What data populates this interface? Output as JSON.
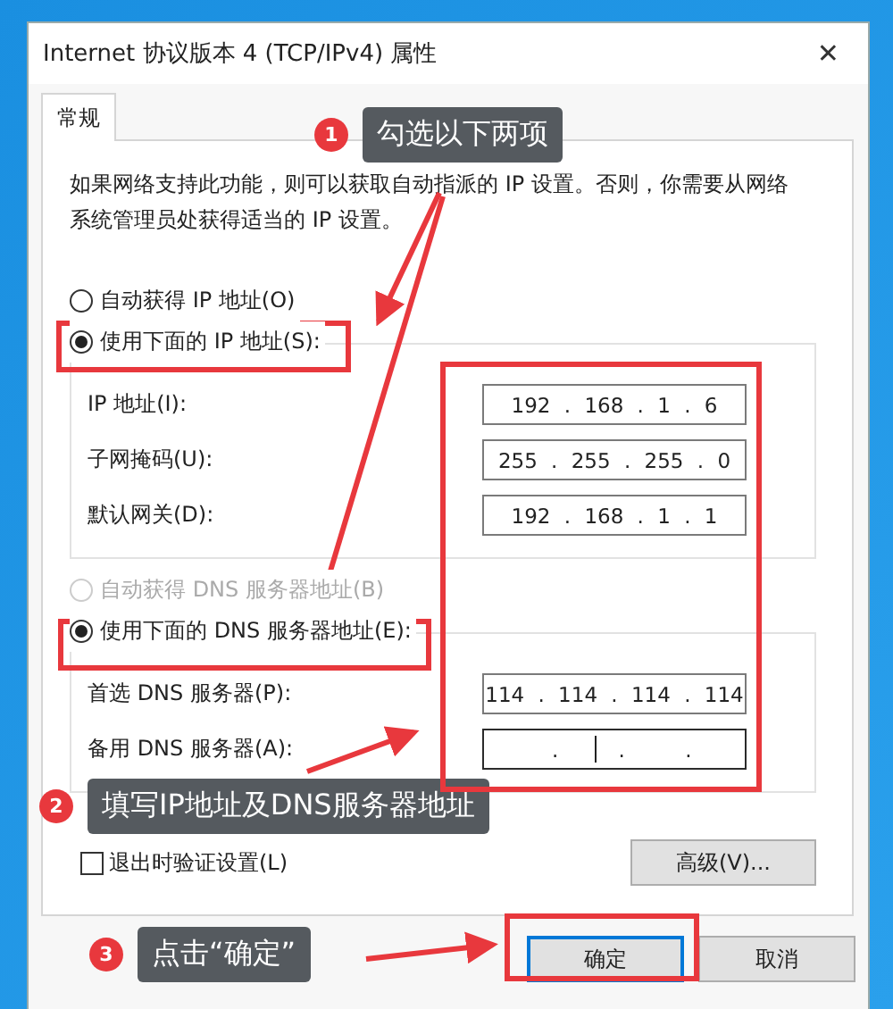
{
  "window": {
    "title": "Internet 协议版本 4 (TCP/IPv4) 属性",
    "close_glyph": "✕"
  },
  "tabs": [
    {
      "label": "常规",
      "selected": true
    }
  ],
  "intro": "如果网络支持此功能，则可以获取自动指派的 IP 设置。否则，你需要从网络系统管理员处获得适当的 IP 设置。",
  "ip_options": [
    {
      "label": "自动获得 IP 地址(O)",
      "selected": false,
      "disabled": false
    },
    {
      "label": "使用下面的 IP 地址(S):",
      "selected": true,
      "disabled": false
    }
  ],
  "ip_fields": [
    {
      "label": "IP 地址(I):",
      "value": "192 . 168 . 1 . 6",
      "focused": false
    },
    {
      "label": "子网掩码(U):",
      "value": "255 . 255 . 255 . 0",
      "focused": false
    },
    {
      "label": "默认网关(D):",
      "value": "192 . 168 . 1 . 1",
      "focused": false
    }
  ],
  "dns_options": [
    {
      "label": "自动获得 DNS 服务器地址(B)",
      "selected": false,
      "disabled": true
    },
    {
      "label": "使用下面的 DNS 服务器地址(E):",
      "selected": true,
      "disabled": false
    }
  ],
  "dns_fields": [
    {
      "label": "首选 DNS 服务器(P):",
      "value": "114 . 114 . 114 . 114",
      "focused": false
    },
    {
      "label": "备用 DNS 服务器(A):",
      "value": ". . .",
      "focused": true
    }
  ],
  "validate_checkbox": {
    "label": "退出时验证设置(L)",
    "checked": false
  },
  "advanced_button": "高级(V)...",
  "buttons": [
    {
      "label": "确定",
      "default": true
    },
    {
      "label": "取消",
      "default": false
    }
  ],
  "annotations": [
    {
      "number": "1",
      "text": "勾选以下两项"
    },
    {
      "number": "2",
      "text": "填写IP地址及DNS服务器地址"
    },
    {
      "number": "3",
      "text": "点击“确定”"
    }
  ]
}
